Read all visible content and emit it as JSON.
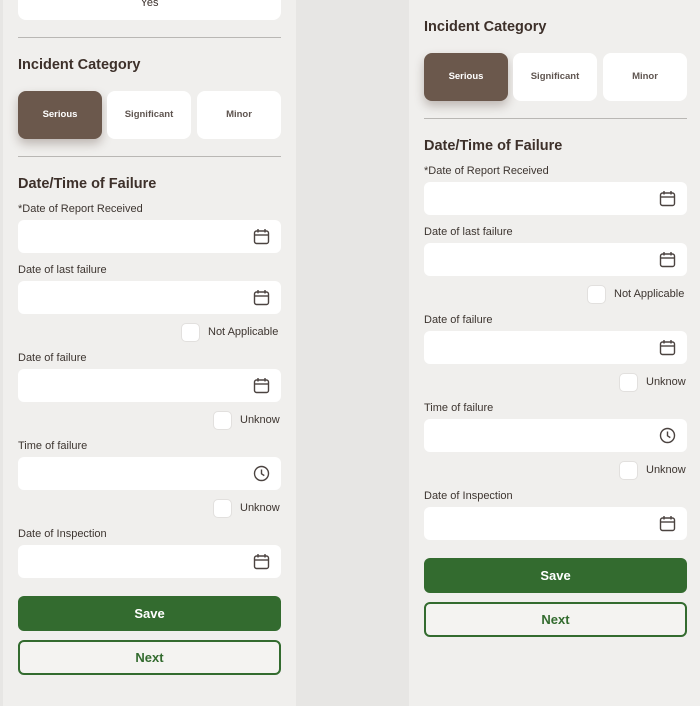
{
  "top_card": {
    "value": "Yes"
  },
  "incident_category": {
    "title": "Incident Category",
    "options": [
      "Serious",
      "Significant",
      "Minor"
    ],
    "selected": "Serious"
  },
  "failure": {
    "title": "Date/Time of Failure",
    "date_report_received_label": "*Date of Report Received",
    "date_last_failure_label": "Date of last failure",
    "not_applicable_label": "Not Applicable",
    "date_failure_label": "Date of failure",
    "unknown_label": "Unknow",
    "time_failure_label": "Time of failure",
    "date_inspection_label": "Date of Inspection"
  },
  "actions": {
    "save": "Save",
    "next": "Next"
  },
  "icons": {
    "date": "calendar-icon",
    "time": "clock-icon"
  },
  "colors": {
    "background": "#e7e6e4",
    "panel": "#f0efed",
    "selected_category": "#6b584c",
    "primary_green": "#336b2f",
    "heading_text": "#3d302a"
  }
}
